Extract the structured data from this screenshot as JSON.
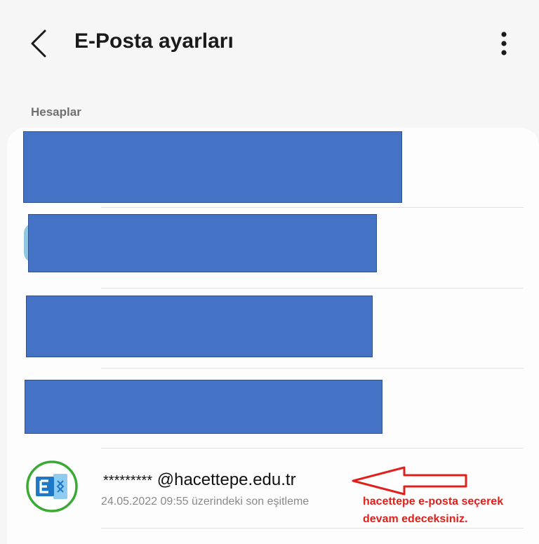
{
  "header": {
    "title": "E-Posta ayarları",
    "back_icon": "chevron-left-icon",
    "more_icon": "more-vertical-icon"
  },
  "accounts_section": {
    "label": "Hesaplar"
  },
  "account": {
    "masked_user": "*********",
    "domain": "@hacettepe.edu.tr",
    "sync_status": "24.05.2022  09:55 üzerindeki son eşitleme",
    "icon": "exchange-icon"
  },
  "annotation": {
    "line1": "hacettepe e-posta seçerek",
    "line2": "devam edeceksiniz.",
    "color": "#e0201b"
  },
  "colors": {
    "redaction": "#4472c4",
    "exchange_ring": "#3aaa35",
    "exchange_blue": "#1e78c8"
  }
}
